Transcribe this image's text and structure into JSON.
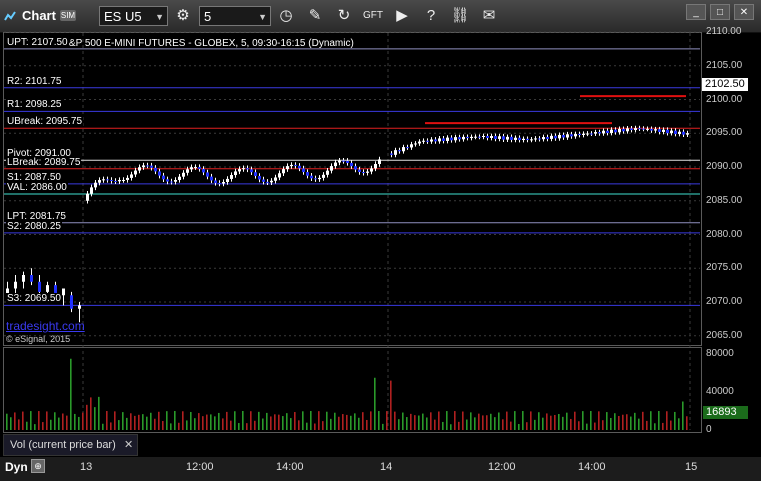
{
  "window": {
    "title": "Chart",
    "badge": "SIM"
  },
  "toolbar": {
    "symbol": "ES U5",
    "interval": "5",
    "icons": [
      "gear-icon",
      "clock-icon",
      "pencil-icon",
      "refresh-icon",
      "gift-icon",
      "play-icon",
      "help-icon",
      "link-icon",
      "message-icon"
    ]
  },
  "chart_header": "ES #F, S&P 500 E-MINI FUTURES - GLOBEX, 5, 09:30-16:15 (Dynamic)",
  "price_axis": [
    "2110.00",
    "2105.00",
    "2100.00",
    "2095.00",
    "2090.00",
    "2085.00",
    "2080.00",
    "2075.00",
    "2070.00",
    "2065.00"
  ],
  "current_price": "2102.50",
  "levels": [
    {
      "label": "UPT: 2107.50",
      "price": 2107.5,
      "color": "#9090c0"
    },
    {
      "label": "R2: 2101.75",
      "price": 2101.75,
      "color": "#3a3ae0"
    },
    {
      "label": "R1: 2098.25",
      "price": 2098.25,
      "color": "#3a3ae0"
    },
    {
      "label": "UBreak: 2095.75",
      "price": 2095.75,
      "color": "#e02020"
    },
    {
      "label": "Pivot: 2091.00",
      "price": 2091.0,
      "color": "#e0e0e0"
    },
    {
      "label": "LBreak: 2089.75",
      "price": 2089.75,
      "color": "#e02020"
    },
    {
      "label": "S1: 2087.50",
      "price": 2087.5,
      "color": "#3a3ae0"
    },
    {
      "label": "VAL: 2086.00",
      "price": 2086.0,
      "color": "#40e0d0"
    },
    {
      "label": "LPT: 2081.75",
      "price": 2081.75,
      "color": "#9090c0"
    },
    {
      "label": "S2: 2080.25",
      "price": 2080.25,
      "color": "#3a3ae0"
    },
    {
      "label": "S3: 2069.50",
      "price": 2069.5,
      "color": "#3a3ae0"
    }
  ],
  "watermark": "tradesight.com",
  "copyright": "© eSignal, 2015",
  "volume": {
    "axis": [
      "80000",
      "40000",
      "0"
    ],
    "current": "16893",
    "label": "Vol (current price bar)"
  },
  "time_axis": {
    "mode": "Dyn",
    "ticks": [
      "13",
      "12:00",
      "14:00",
      "14",
      "12:00",
      "14:00",
      "15"
    ]
  }
}
